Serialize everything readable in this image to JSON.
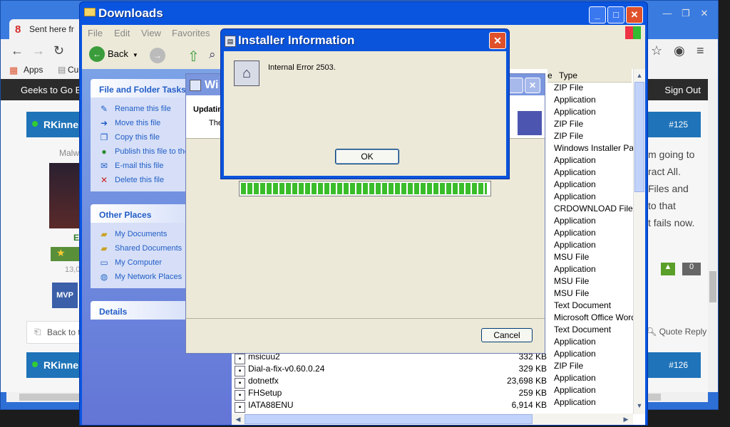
{
  "browser": {
    "tab_title": "Sent here fr",
    "tab_icon": "8",
    "bookmarks": [
      "Apps",
      "Cu"
    ],
    "site_brand": "Geeks to Go Bl",
    "sign_out": "Sign Out",
    "post1_user": "RKinner",
    "post1_num": "#125",
    "post2_user": "RKinner",
    "post2_num": "#126",
    "post_lines": [
      "m going to",
      "ract All.",
      "Files and",
      "to that",
      "t fails now."
    ],
    "vote_count": "0",
    "quote_reply": "Quote Reply",
    "back_to": "Back to t",
    "left_labels": [
      "Malw",
      "E",
      "13,0",
      "MVP"
    ]
  },
  "explorer": {
    "title": "Downloads",
    "menu": [
      "File",
      "Edit",
      "View",
      "Favorites"
    ],
    "back_label": "Back",
    "file_tasks": {
      "title": "File and Folder Tasks",
      "items": [
        "Rename this file",
        "Move this file",
        "Copy this file",
        "Publish this file to the Web",
        "E-mail this file",
        "Delete this file"
      ]
    },
    "other_places": {
      "title": "Other Places",
      "items": [
        "My Documents",
        "Shared Documents",
        "My Computer",
        "My Network Places"
      ]
    },
    "details_title": "Details",
    "type_header": "Type",
    "size_header_tail": "e",
    "types": [
      "ZIP File",
      "Application",
      "Application",
      "ZIP File",
      "ZIP File",
      "Windows Installer Package",
      "Application",
      "Application",
      "Application",
      "Application",
      "CRDOWNLOAD File",
      "Application",
      "Application",
      "Application",
      "MSU File",
      "Application",
      "MSU File",
      "MSU File",
      "Text Document",
      "Microsoft Office Word",
      "Text Document",
      "Application",
      "Application",
      "ZIP File",
      "Application",
      "Application",
      "Application"
    ],
    "files": [
      {
        "name": "msicuu2",
        "size": "332 KB"
      },
      {
        "name": "Dial-a-fix-v0.60.0.24",
        "size": "329 KB"
      },
      {
        "name": "dotnetfx",
        "size": "23,698 KB"
      },
      {
        "name": "FHSetup",
        "size": "259 KB"
      },
      {
        "name": "IATA88ENU",
        "size": "6,914 KB"
      }
    ]
  },
  "installer_window": {
    "title": "Wi",
    "heading": "Updatin",
    "subtext": "The",
    "progress_fraction": 0.99,
    "cancel_label": "Cancel"
  },
  "dialog": {
    "title": "Installer Information",
    "message": "Internal Error 2503.",
    "ok_label": "OK",
    "close_glyph": "✕"
  },
  "colors": {
    "xp_blue": "#0a54dc",
    "close_red": "#e0512b",
    "progress_green": "#3bbd2b"
  }
}
